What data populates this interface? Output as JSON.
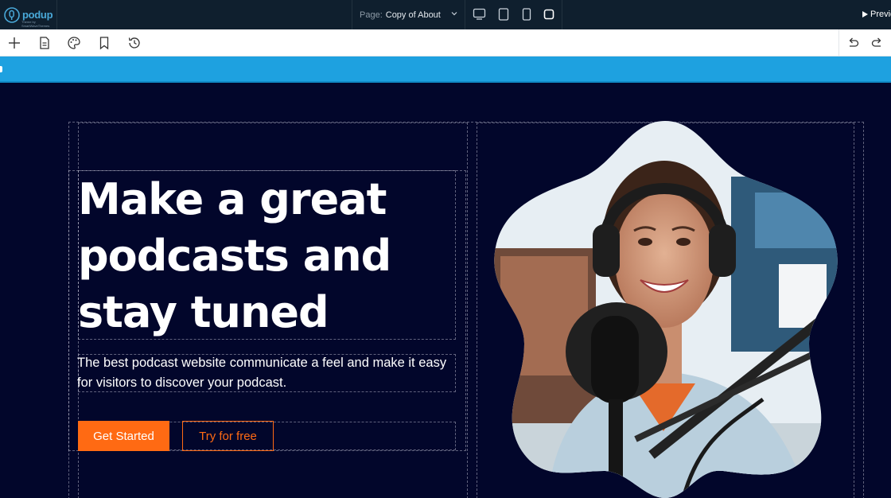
{
  "topbar": {
    "logo_text": "podup",
    "logo_subtitle": "Theme by SmartWaveThemes",
    "page_label": "Page:",
    "page_value": "Copy of About",
    "devices": [
      "desktop-icon",
      "tablet-landscape-icon",
      "tablet-icon",
      "mobile-icon"
    ],
    "preview_label": "Preview"
  },
  "toolbar": {
    "icons": [
      "plus-icon",
      "page-icon",
      "palette-icon",
      "bookmark-icon",
      "history-icon"
    ],
    "right_icons": [
      "undo-icon",
      "redo-icon"
    ]
  },
  "hero": {
    "headline": "Make a great podcasts and stay tuned",
    "subtext": "The best podcast website communicate a feel and make it easy for visitors to discover your podcast.",
    "primary_button": "Get Started",
    "secondary_button": "Try for free",
    "image_alt": "woman-with-headphones-and-microphone-photo"
  },
  "colors": {
    "canvas_bg": "#02062b",
    "accent_orange": "#ff6a13",
    "strip_blue": "#1ea1e0",
    "topbar_bg": "#0f1f2e"
  }
}
